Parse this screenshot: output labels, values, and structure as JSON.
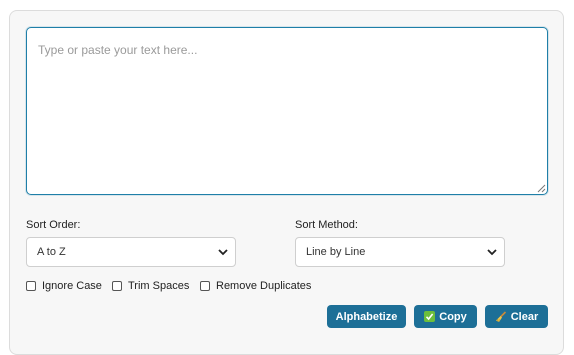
{
  "editor": {
    "placeholder": "Type or paste your text here..."
  },
  "sort_order": {
    "label": "Sort Order:",
    "selected": "A to Z"
  },
  "sort_method": {
    "label": "Sort Method:",
    "selected": "Line by Line"
  },
  "options": {
    "ignore_case": {
      "label": "Ignore Case",
      "checked": false
    },
    "trim_spaces": {
      "label": "Trim Spaces",
      "checked": false
    },
    "remove_duplicates": {
      "label": "Remove Duplicates",
      "checked": false
    }
  },
  "actions": {
    "alphabetize_label": "Alphabetize",
    "copy_label": "Copy",
    "clear_label": "Clear"
  },
  "icons": {
    "copy": "check-box-icon",
    "clear": "broom-icon"
  },
  "colors": {
    "button_bg": "#1d6f97",
    "focus_border": "#1f7fa8",
    "check_green": "#6cbf3c"
  }
}
